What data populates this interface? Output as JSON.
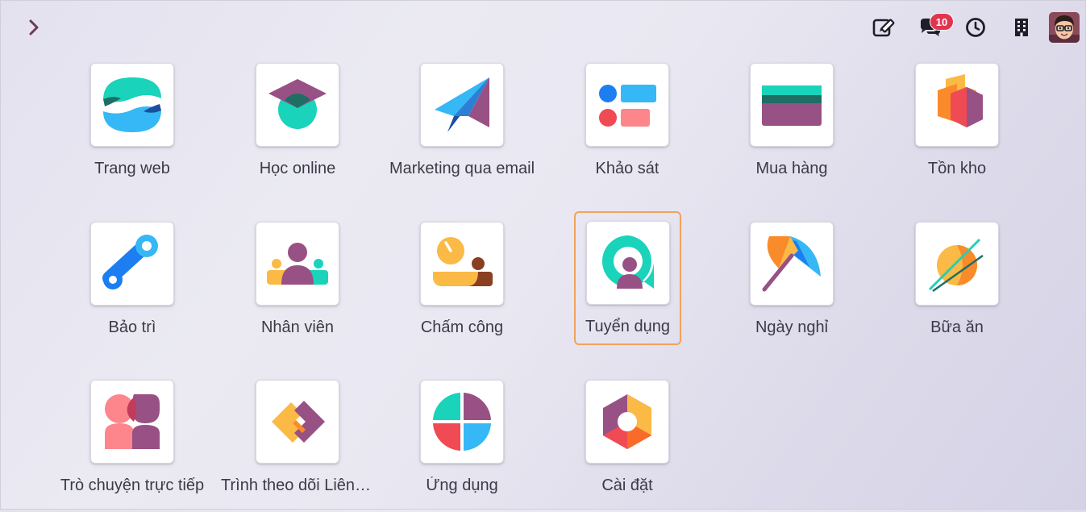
{
  "systray": {
    "messages_count": "10"
  },
  "apps": [
    {
      "label": "Trang web",
      "icon": "website-icon"
    },
    {
      "label": "Học online",
      "icon": "elearning-icon"
    },
    {
      "label": "Marketing qua email",
      "icon": "email-marketing-icon"
    },
    {
      "label": "Khảo sát",
      "icon": "survey-icon"
    },
    {
      "label": "Mua hàng",
      "icon": "purchase-icon"
    },
    {
      "label": "Tồn kho",
      "icon": "inventory-icon"
    },
    {
      "label": "Bảo trì",
      "icon": "maintenance-icon"
    },
    {
      "label": "Nhân viên",
      "icon": "employees-icon"
    },
    {
      "label": "Chấm công",
      "icon": "attendance-icon"
    },
    {
      "label": "Tuyển dụng",
      "icon": "recruitment-icon"
    },
    {
      "label": "Ngày nghỉ",
      "icon": "time-off-icon"
    },
    {
      "label": "Bữa ăn",
      "icon": "lunch-icon"
    },
    {
      "label": "Trò chuyện trực tiếp",
      "icon": "live-chat-icon"
    },
    {
      "label": "Trình theo dõi Liên kết",
      "icon": "link-tracker-icon"
    },
    {
      "label": "Ứng dụng",
      "icon": "apps-icon"
    },
    {
      "label": "Cài đặt",
      "icon": "settings-icon"
    }
  ],
  "colors": {
    "purple": "#985184",
    "teal": "#1ad3bb",
    "blue": "#35b8f5",
    "navy": "#1c4ea0",
    "orange": "#fbb945",
    "red": "#f04a54",
    "pink": "#fc868b",
    "focus": "#f1a35c"
  }
}
